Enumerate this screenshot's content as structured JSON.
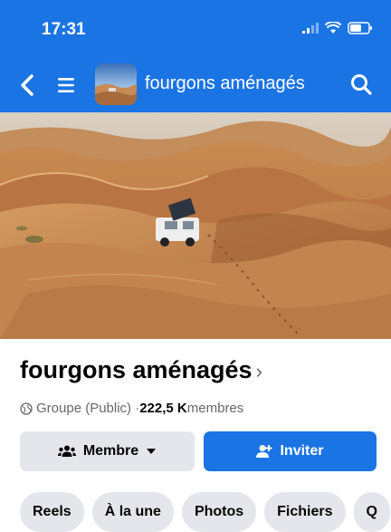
{
  "status_bar": {
    "time": "17:31"
  },
  "nav": {
    "title": "fourgons aménagés"
  },
  "group": {
    "name": "fourgons aménagés",
    "name_chevron": "›",
    "type": "Groupe (Public) · ",
    "member_count": "222,5 K",
    "member_suffix": " membres"
  },
  "actions": {
    "member_label": "Membre",
    "invite_label": "Inviter"
  },
  "tabs": [
    {
      "label": "Reels"
    },
    {
      "label": "À la une"
    },
    {
      "label": "Photos"
    },
    {
      "label": "Fichiers"
    },
    {
      "label": "Q"
    }
  ],
  "colors": {
    "brand": "#1b74e4",
    "chip_bg": "#e4e6eb"
  }
}
